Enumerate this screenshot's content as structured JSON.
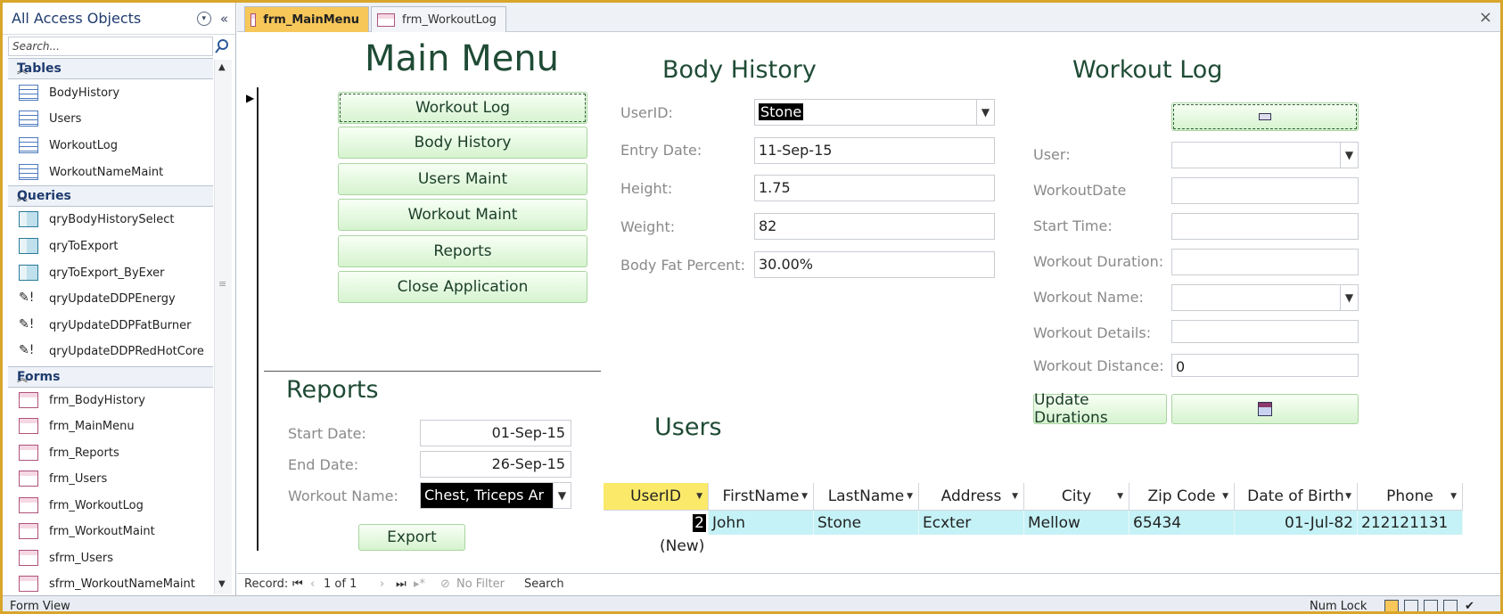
{
  "nav": {
    "title": "All Access Objects",
    "search_placeholder": "Search...",
    "groups": [
      {
        "label": "Tables",
        "items": [
          "BodyHistory",
          "Users",
          "WorkoutLog",
          "WorkoutNameMaint"
        ]
      },
      {
        "label": "Queries",
        "items": [
          "qryBodyHistorySelect",
          "qryToExport",
          "qryToExport_ByExer",
          "qryUpdateDDPEnergy",
          "qryUpdateDDPFatBurner",
          "qryUpdateDDPRedHotCore"
        ]
      },
      {
        "label": "Forms",
        "items": [
          "frm_BodyHistory",
          "frm_MainMenu",
          "frm_Reports",
          "frm_Users",
          "frm_WorkoutLog",
          "frm_WorkoutMaint",
          "sfrm_Users",
          "sfrm_WorkoutNameMaint"
        ]
      }
    ]
  },
  "tabs": [
    {
      "label": "frm_MainMenu",
      "active": true
    },
    {
      "label": "frm_WorkoutLog",
      "active": false
    }
  ],
  "main_menu": {
    "title": "Main Menu",
    "buttons": [
      "Workout Log",
      "Body History",
      "Users Maint",
      "Workout Maint",
      "Reports",
      "Close Application"
    ]
  },
  "body_history": {
    "title": "Body History",
    "fields": [
      {
        "label": "UserID:",
        "value": "Stone"
      },
      {
        "label": "Entry Date:",
        "value": "11-Sep-15"
      },
      {
        "label": "Height:",
        "value": "1.75"
      },
      {
        "label": "Weight:",
        "value": "82"
      },
      {
        "label": "Body Fat Percent:",
        "value": "30.00%"
      }
    ]
  },
  "workout_log": {
    "title": "Workout Log",
    "fields": [
      {
        "label": "User:",
        "value": ""
      },
      {
        "label": "WorkoutDate",
        "value": ""
      },
      {
        "label": "Start Time:",
        "value": ""
      },
      {
        "label": "Workout Duration:",
        "value": ""
      },
      {
        "label": "Workout Name:",
        "value": ""
      },
      {
        "label": "Workout Details:",
        "value": ""
      },
      {
        "label": "Workout Distance:",
        "value": "0"
      }
    ],
    "update_button": "Update Durations"
  },
  "reports": {
    "title": "Reports",
    "fields": [
      {
        "label": "Start Date:",
        "value": "01-Sep-15"
      },
      {
        "label": "End Date:",
        "value": "26-Sep-15"
      },
      {
        "label": "Workout Name:",
        "value": "Chest, Triceps Ar"
      }
    ],
    "export_button": "Export"
  },
  "users": {
    "title": "Users",
    "columns": [
      "UserID",
      "FirstName",
      "LastName",
      "Address",
      "City",
      "Zip Code",
      "Date of Birth",
      "Phone"
    ],
    "rows": [
      [
        "2",
        "John",
        "Stone",
        "Ecxter",
        "Mellow",
        "65434",
        "01-Jul-82",
        "212121131"
      ]
    ],
    "new_row": "(New)"
  },
  "record_nav": {
    "label": "Record:",
    "position": "1 of 1",
    "filter": "No Filter",
    "search": "Search"
  },
  "status": {
    "view": "Form View",
    "numlock": "Num Lock"
  },
  "colors": {
    "accent_tab": "#f7c75a",
    "button_green": "#d6f3cf",
    "heading_green": "#1f4b35",
    "row_highlight": "#c5f2f6",
    "selected_header": "#fbe96a"
  }
}
